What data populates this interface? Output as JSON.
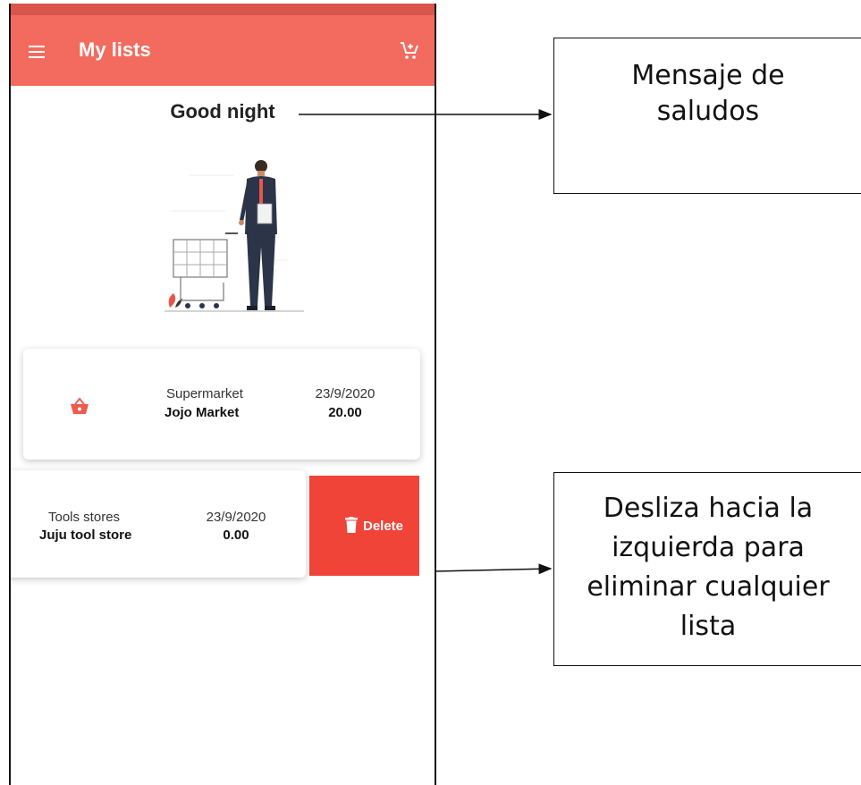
{
  "appbar": {
    "title": "My lists",
    "menu_icon": "menu-icon",
    "cart_icon": "add-shopping-cart-icon",
    "color": "#f26b5e"
  },
  "greeting": "Good night",
  "illustration": "person-with-shopping-cart-illustration",
  "lists": [
    {
      "category": "Supermarket",
      "name": "Jojo Market",
      "date": "23/9/2020",
      "amount": "20.00",
      "icon": "shopping-basket-icon"
    },
    {
      "category": "Tools stores",
      "name": "Juju tool store",
      "date": "23/9/2020",
      "amount": "0.00"
    }
  ],
  "delete_action": {
    "label": "Delete",
    "icon": "trash-icon",
    "color": "#f04438"
  },
  "callouts": {
    "greeting_message": [
      "Mensaje de",
      "saludos"
    ],
    "swipe_hint": [
      "Desliza hacia la",
      "izquierda para",
      "eliminar cualquier",
      "lista"
    ]
  }
}
